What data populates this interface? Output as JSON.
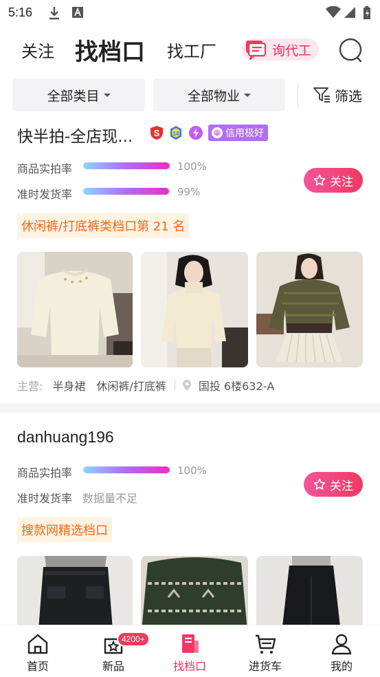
{
  "status_bar": {
    "time": "5:16"
  },
  "top_nav": {
    "tabs": [
      {
        "label": "关注"
      },
      {
        "label": "找档口"
      },
      {
        "label": "找工厂"
      }
    ],
    "inquiry_label": "询代工"
  },
  "filters": {
    "category": "全部类目",
    "property": "全部物业",
    "filter_label": "筛选"
  },
  "shops": [
    {
      "name": "快半拍-全店现...",
      "credit_badge": "信用极好",
      "metrics": [
        {
          "label": "商品实拍率",
          "value": "100%",
          "fill": 1.0
        },
        {
          "label": "准时发货率",
          "value": "99%",
          "fill": 0.99
        }
      ],
      "follow_label": "关注",
      "rank_tag": "休闲裤/打底裤类档口第 21 名",
      "main_label": "主营:",
      "main_categories": [
        "半身裙",
        "休闲裤/打底裤"
      ],
      "location": "国投 6楼632-A"
    },
    {
      "name": "danhuang196",
      "metrics": [
        {
          "label": "商品实拍率",
          "value": "100%",
          "fill": 1.0
        },
        {
          "label": "准时发货率",
          "value": "数据量不足"
        }
      ],
      "follow_label": "关注",
      "rank_tag": "搜款网精选档口"
    }
  ],
  "bottom_nav": [
    {
      "label": "首页",
      "icon": "home-icon"
    },
    {
      "label": "新品",
      "icon": "star-bag-icon",
      "badge": "4200+"
    },
    {
      "label": "找档口",
      "icon": "shop-doc-icon",
      "active": true
    },
    {
      "label": "进货车",
      "icon": "cart-icon"
    },
    {
      "label": "我的",
      "icon": "person-icon"
    }
  ],
  "colors": {
    "accent": "#e8315b",
    "rank_tag_text": "#f06a1a",
    "credit_badge": "#b26ff0"
  }
}
